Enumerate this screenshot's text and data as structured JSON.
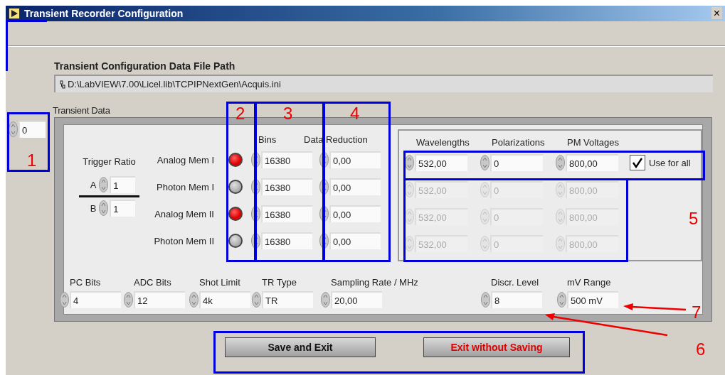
{
  "window": {
    "title": "Transient Recorder Configuration",
    "close": "×"
  },
  "file_path": {
    "label": "Transient Configuration Data File Path",
    "value": "D:\\LabVIEW\\7.00\\Licel.lib\\TCPIPNextGen\\Acquis.ini"
  },
  "transient_data": {
    "label": "Transient Data",
    "index": "0",
    "trigger_ratio": {
      "label": "Trigger Ratio",
      "a_label": "A",
      "a": "1",
      "b_label": "B",
      "b": "1"
    },
    "columns": {
      "bins": "Bins",
      "data_reduction": "Data Reduction"
    },
    "memories": [
      {
        "name": "Analog Mem I",
        "on": true,
        "bins": "16380",
        "data_reduction": "0,00"
      },
      {
        "name": "Photon Mem I",
        "on": false,
        "bins": "16380",
        "data_reduction": "0,00"
      },
      {
        "name": "Analog Mem II",
        "on": true,
        "bins": "16380",
        "data_reduction": "0,00"
      },
      {
        "name": "Photon Mem II",
        "on": false,
        "bins": "16380",
        "data_reduction": "0,00"
      }
    ],
    "channel_columns": {
      "wavelengths": "Wavelengths",
      "polarizations": "Polarizations",
      "pm_voltages": "PM Voltages"
    },
    "use_for_all": {
      "label": "Use for all",
      "checked": true
    },
    "channels": [
      {
        "wavelength": "532,00",
        "polarization": "0",
        "pm_voltage": "800,00",
        "disabled": false
      },
      {
        "wavelength": "532,00",
        "polarization": "0",
        "pm_voltage": "800,00",
        "disabled": true
      },
      {
        "wavelength": "532,00",
        "polarization": "0",
        "pm_voltage": "800,00",
        "disabled": true
      },
      {
        "wavelength": "532,00",
        "polarization": "0",
        "pm_voltage": "800,00",
        "disabled": true
      }
    ],
    "settings": [
      {
        "label": "PC Bits",
        "value": "4"
      },
      {
        "label": "ADC Bits",
        "value": "12"
      },
      {
        "label": "Shot Limit",
        "value": "4k"
      },
      {
        "label": "TR Type",
        "value": "TR"
      },
      {
        "label": "Sampling Rate / MHz",
        "value": "20,00"
      },
      {
        "label": "Discr. Level",
        "value": "8"
      },
      {
        "label": "mV Range",
        "value": "500 mV"
      }
    ]
  },
  "buttons": [
    {
      "label": "Save and Exit",
      "kind": "normal"
    },
    {
      "label": "Exit without Saving",
      "kind": "warning"
    }
  ],
  "annotations": [
    "1",
    "2",
    "3",
    "4",
    "5",
    "6",
    "7"
  ]
}
